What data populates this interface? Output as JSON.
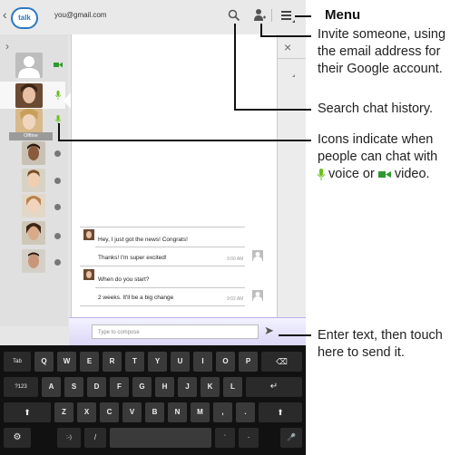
{
  "tablet": {
    "account_email": "you@gmail.com",
    "logo_text": "talk",
    "sidebar_expand": "›",
    "close_x": "×",
    "offline_label": "Offline",
    "messages": [
      {
        "text": "Hey, I just got the news! Congrats!",
        "from": "other",
        "time": ""
      },
      {
        "text": "Thanks! I'm super excited!",
        "from": "me",
        "time": "9:00 AM"
      },
      {
        "text": "When do you start?",
        "from": "other",
        "time": ""
      },
      {
        "text": "2 weeks. It'll be a big change",
        "from": "me",
        "time": "9:02 AM"
      }
    ],
    "compose_placeholder": "Type to compose",
    "send_glyph": "➤",
    "keyboard": {
      "row1": [
        "Tab",
        "Q",
        "W",
        "E",
        "R",
        "T",
        "Y",
        "U",
        "I",
        "O",
        "P",
        "⌫"
      ],
      "row2": [
        "?123",
        "A",
        "S",
        "D",
        "F",
        "G",
        "H",
        "J",
        "K",
        "L",
        "↵"
      ],
      "row3": [
        "⬆",
        "Z",
        "X",
        "C",
        "V",
        "B",
        "N",
        "M",
        ",",
        ".",
        "⬆"
      ],
      "row4": [
        "⚙",
        ":-)",
        "/",
        "",
        "'",
        "-",
        "🎤"
      ]
    }
  },
  "callouts": {
    "menu": "Menu",
    "invite": [
      "Invite someone, using",
      "the email address for",
      "their Google account."
    ],
    "search": "Search chat history.",
    "icons": [
      "Icons indicate when",
      "people can chat with"
    ],
    "icons_voice": "voice or",
    "icons_video": "video.",
    "enter": [
      "Enter text, then touch",
      "here to send it."
    ]
  },
  "colors": {
    "mic": "#6bbf1f",
    "video": "#2e9a2e",
    "compose_tint": "#dcd7f7"
  },
  "icons": [
    "talk-logo-icon",
    "search-icon",
    "add-person-icon",
    "menu-icon",
    "mic-icon",
    "video-icon",
    "send-icon",
    "close-icon"
  ]
}
